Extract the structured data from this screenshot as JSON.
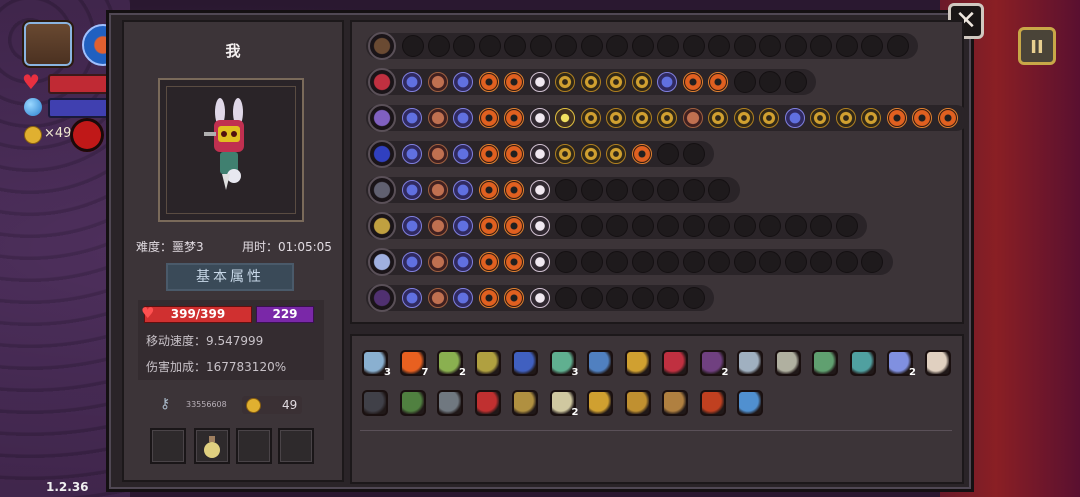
{
  "version": "1.2.36",
  "hud": {
    "coins": "×49",
    "pause_label": "II",
    "icons": [
      "chest-icon",
      "orb-icon",
      "heart-icon",
      "mana-orb-icon",
      "coin-icon",
      "ninja-mask-icon"
    ]
  },
  "modal": {
    "close_label": "✕",
    "character": {
      "name": "我",
      "difficulty": "难度：噩梦3",
      "time": "用时：01:05:05"
    },
    "attributes": {
      "title": "基本属性",
      "hp": "399/399",
      "mana": "229",
      "move_speed": "移动速度：9.547999",
      "damage_bonus": "伤害加成：167783120%"
    },
    "resources": {
      "keys": "33556608",
      "coins": "49"
    },
    "slots": [
      {
        "name": "slot-empty"
      },
      {
        "name": "slot-potion"
      },
      {
        "name": "slot-empty"
      },
      {
        "name": "slot-empty"
      }
    ]
  },
  "weapon_rows": [
    {
      "weapon": "chest-icon",
      "filled": [],
      "empty": 20
    },
    {
      "weapon": "red-orb-icon",
      "filled": [
        "gem",
        "seed",
        "gem",
        "tri",
        "tri",
        "skull",
        "wave",
        "wave",
        "wave",
        "wave",
        "gem",
        "tri",
        "tri"
      ],
      "empty": 3
    },
    {
      "weapon": "crescent-staff-icon",
      "filled": [
        "gem",
        "seed",
        "gem",
        "tri",
        "tri",
        "skull",
        "spark",
        "wave",
        "wave",
        "wave",
        "wave",
        "seed",
        "wave",
        "wave",
        "wave",
        "gem",
        "wave",
        "wave",
        "wave",
        "tri",
        "tri",
        "tri"
      ],
      "empty": 0
    },
    {
      "weapon": "blue-orb-icon",
      "filled": [
        "gem",
        "seed",
        "gem",
        "tri",
        "tri",
        "skull",
        "wave",
        "wave",
        "wave",
        "tri"
      ],
      "empty": 2
    },
    {
      "weapon": "wand-icon",
      "filled": [
        "gem",
        "seed",
        "gem",
        "tri",
        "tri",
        "skull"
      ],
      "empty": 7
    },
    {
      "weapon": "star-staff-icon",
      "filled": [
        "gem",
        "seed",
        "gem",
        "tri",
        "tri",
        "skull"
      ],
      "empty": 12
    },
    {
      "weapon": "crystal-wand-icon",
      "filled": [
        "gem",
        "seed",
        "gem",
        "tri",
        "tri",
        "skull"
      ],
      "empty": 13
    },
    {
      "weapon": "dark-staff-icon",
      "filled": [
        "gem",
        "seed",
        "gem",
        "tri",
        "tri",
        "skull"
      ],
      "empty": 6
    }
  ],
  "items_row1": [
    {
      "name": "ghost-shield-icon",
      "count": "3",
      "color": "#8ab0d0"
    },
    {
      "name": "heart-item-icon",
      "count": "7",
      "color": "#e86020"
    },
    {
      "name": "leaf-sprout-icon",
      "count": "2",
      "color": "#8ab050"
    },
    {
      "name": "vine-icon",
      "count": "",
      "color": "#b0a040"
    },
    {
      "name": "potion-bottle-icon",
      "count": "",
      "color": "#4060c0"
    },
    {
      "name": "crystal-cube-icon",
      "count": "3",
      "color": "#60b090"
    },
    {
      "name": "blue-lamp-icon",
      "count": "",
      "color": "#5080c0"
    },
    {
      "name": "scroll-icon",
      "count": "",
      "color": "#d0a030"
    },
    {
      "name": "red-feather-icon",
      "count": "",
      "color": "#c03040"
    },
    {
      "name": "purple-hat-icon",
      "count": "2",
      "color": "#704080"
    },
    {
      "name": "silver-key-icon",
      "count": "",
      "color": "#a0b0c0"
    },
    {
      "name": "magnifier-icon",
      "count": "",
      "color": "#b0b0a0"
    },
    {
      "name": "green-ufo-icon",
      "count": "",
      "color": "#60a070"
    },
    {
      "name": "globe-icon",
      "count": "",
      "color": "#50a0a0"
    },
    {
      "name": "lotus-icon",
      "count": "2",
      "color": "#8090e0"
    },
    {
      "name": "quill-icon",
      "count": "",
      "color": "#e0d0c0"
    }
  ],
  "items_row2": [
    {
      "name": "dark-cloak-icon",
      "count": "",
      "color": "#404048"
    },
    {
      "name": "green-boot-icon",
      "count": "",
      "color": "#508040"
    },
    {
      "name": "gray-gem-icon",
      "count": "",
      "color": "#707880"
    },
    {
      "name": "demon-mask-icon",
      "count": "",
      "color": "#c03030"
    },
    {
      "name": "antler-icon",
      "count": "",
      "color": "#b09040"
    },
    {
      "name": "fang-necklace-icon",
      "count": "2",
      "color": "#d0c8a0"
    },
    {
      "name": "golden-bell-icon",
      "count": "",
      "color": "#d0a030"
    },
    {
      "name": "golden-gauntlet-icon",
      "count": "",
      "color": "#c09030"
    },
    {
      "name": "hourglass-icon",
      "count": "",
      "color": "#b08040"
    },
    {
      "name": "red-bird-icon",
      "count": "",
      "color": "#c04020"
    },
    {
      "name": "blue-lens-icon",
      "count": "",
      "color": "#5090d0"
    }
  ]
}
